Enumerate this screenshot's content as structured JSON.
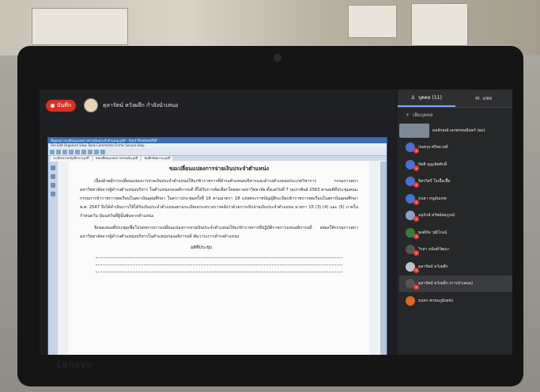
{
  "recording": {
    "label": "บันทึก"
  },
  "presenter": {
    "label": "ดุลารัตน์ หวังผลึก กำลังนำเสนอ"
  },
  "panel": {
    "people_tab": "บุคคล (11)",
    "chat_tab": "แชท",
    "invite_label": "เพิ่มบุคคล",
    "participants": [
      {
        "name": "ดลลักษณ์ เอกพรหมมินทร์ (ผม)"
      },
      {
        "name": "ก่อสกุล ศรีสมวงศ์"
      },
      {
        "name": "กิตติ บุญเลิศศักดิ์"
      },
      {
        "name": "จิตรวิตรี ใจเอื้อเฟื้อ"
      },
      {
        "name": "ธนยา หนูมันเทพ"
      },
      {
        "name": "อนุรักษ์ ทรัพย์สมบูรณ์"
      },
      {
        "name": "พงศ์ภัค วุฒิโรจน์"
      },
      {
        "name": "วิรสา อนันต์วัฒนา"
      },
      {
        "name": "ดุลารัตน์ หวังผลึก"
      },
      {
        "name": "ดุลารัตน์ หวังผลึก (การนำเสนอ)"
      },
      {
        "name": "ธนทร พรหมภูมิเพชร"
      }
    ]
  },
  "document": {
    "window_title": "ขั้นตอนการเปลี่ยนแปลงการจ่ายเงินประจำตำแหน่ง.pdf - Foxit PhantomPDF",
    "menu": "File  Edit  Organize  View  Tools  Comments  Forms  Secure  Help",
    "tabs": [
      "ระเบียบกรมบัญชีกลาง.pdf",
      "ขอเปลี่ยนแปลงการจ่ายเงิน.pdf",
      "บันทึกข้อความ.pdf"
    ],
    "heading": "ขอเปลี่ยนแปลงการจ่ายเงินประจำตำแหน่ง",
    "paragraphs": [
      "เนื่องด้วยมีการเปลี่ยนแปลงการจ่ายเงินประจำตำแหน่งให้แก่ข้าราชการที่ดำรงตำแหน่งบริหารและดำรงตำแหน่งประเภทวิชาการ กรรมการสภามหาวิทยาลัยจากผู้ดำรงตำแหน่งบริหาร ในตำแหน่งรองอธิการบดี ที่ได้รับการคัดเลือกโดยสภามหาวิทยาลัย ตั้งแต่วันที่ 7 กุมภาพันธ์ 2563 ตามมติที่ประชุมคณะกรรมการข้าราชการพลเรือนในสถาบันอุดมศึกษา ในคราวประชุมครั้งที่ 16 ตามมาตรา 18 แห่งพระราชบัญญัติระเบียบข้าราชการพลเรือนในสถาบันอุดมศึกษา พ.ศ. 2547 จึงได้ดำเนินการให้ได้รับเงินประจำตำแหน่งตามระเบียบกระทรวงการคลังว่าด้วยการเบิกจ่ายเงินประจำตำแหน่ง มาตรา 15 (3) (4) และ (5) ภายในกำหนดวัน นับแต่วันที่ผู้นั้นพ้นจากตำแหน่ง",
      "จึงขอเสนอที่ประชุมเพื่อโปรดทราบการเปลี่ยนแปลงการจ่ายเงินประจำตำแหน่งให้แก่ข้าราชการที่ปฏิบัติราชการแทนอธิการบดี ส่งผลให้กรรมการสภามหาวิทยาลัยจากผู้ดำรงตำแหน่งบริหารในตำแหน่งรองอธิการบดี พ้นวาระการดำรงตำแหน่ง"
    ],
    "meeting_label": "มติที่ประชุม"
  },
  "device": {
    "brand": "Lenovo"
  }
}
